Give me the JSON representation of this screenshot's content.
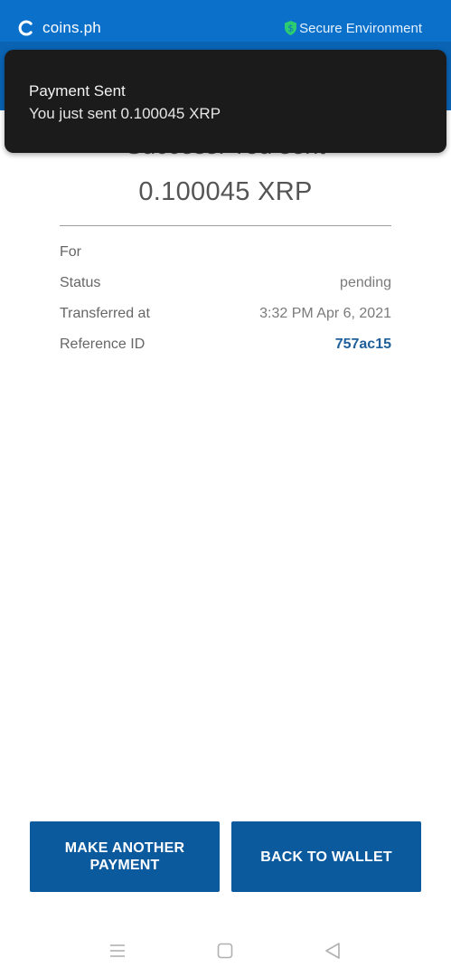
{
  "app": {
    "brand_name": "coins.ph",
    "secure_label": "Secure Environment"
  },
  "toast": {
    "title": "Payment Sent",
    "message": "You just sent 0.100045 XRP"
  },
  "result": {
    "heading": "Success! You sent",
    "amount": "0.100045 XRP"
  },
  "details": [
    {
      "label": "For",
      "value": ""
    },
    {
      "label": "Status",
      "value": "pending"
    },
    {
      "label": "Transferred at",
      "value": "3:32 PM Apr 6, 2021"
    },
    {
      "label": "Reference ID",
      "value": "757ac15"
    }
  ],
  "buttons": {
    "make_another": "MAKE ANOTHER PAYMENT",
    "back_to_wallet": "BACK TO WALLET"
  },
  "icons": {
    "brand": "coins-logo-icon",
    "secure": "shield-dollar-icon",
    "nav_menu": "menu-icon",
    "nav_home": "home-square-icon",
    "nav_back": "back-triangle-icon"
  },
  "colors": {
    "primary": "#0b5a9e",
    "appbar": "#0a63b3",
    "secure_shield": "#2ecc71",
    "reference": "#1f5f9a"
  }
}
